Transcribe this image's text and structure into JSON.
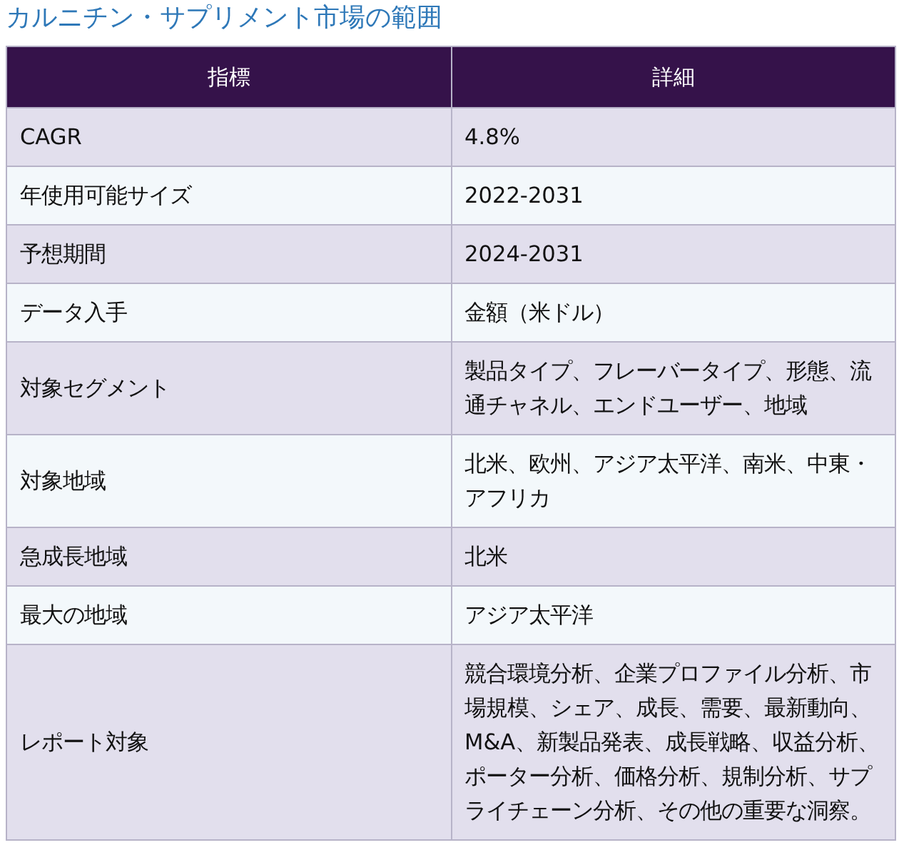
{
  "title": "カルニチン・サプリメント市場の範囲",
  "table": {
    "columns": [
      "指標",
      "詳細"
    ],
    "rows": [
      {
        "metric": "CAGR",
        "detail": "4.8%"
      },
      {
        "metric": "年使用可能サイズ",
        "detail": "2022-2031"
      },
      {
        "metric": "予想期間",
        "detail": "2024-2031"
      },
      {
        "metric": "データ入手",
        "detail": "金額（米ドル）"
      },
      {
        "metric": "対象セグメント",
        "detail": "製品タイプ、フレーバータイプ、形態、流通チャネル、エンドユーザー、地域"
      },
      {
        "metric": "対象地域",
        "detail": "北米、欧州、アジア太平洋、南米、中東・アフリカ"
      },
      {
        "metric": "急成長地域",
        "detail": "北米"
      },
      {
        "metric": "最大の地域",
        "detail": "アジア太平洋"
      },
      {
        "metric": "レポート対象",
        "detail": "競合環境分析、企業プロファイル分析、市場規模、シェア、成長、需要、最新動向、M&A、新製品発表、成長戦略、収益分析、ポーター分析、価格分析、規制分析、サプライチェーン分析、その他の重要な洞察。"
      }
    ]
  }
}
